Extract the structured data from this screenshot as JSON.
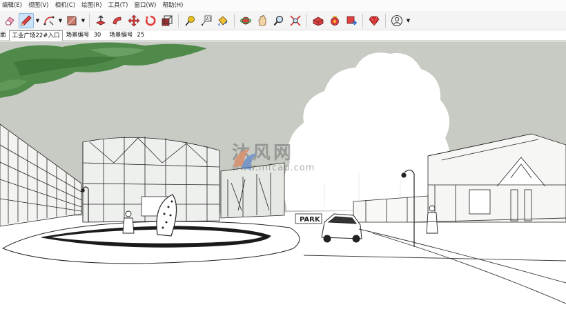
{
  "menu": [
    {
      "label": "编辑(E)"
    },
    {
      "label": "视图(V)"
    },
    {
      "label": "相机(C)"
    },
    {
      "label": "绘图(R)"
    },
    {
      "label": "工具(T)"
    },
    {
      "label": "窗口(W)"
    },
    {
      "label": "帮助(H)"
    }
  ],
  "toolbar": {
    "groups": [
      [
        "eraser-icon",
        "pencil-icon",
        "arc-icon",
        "rectangle-icon"
      ],
      [
        "push-pull-icon",
        "follow-me-icon",
        "move-icon",
        "rotate-icon",
        "scale-icon"
      ],
      [
        "tape-measure-icon",
        "text-icon",
        "paint-bucket-icon"
      ],
      [
        "orbit-icon",
        "pan-icon",
        "zoom-icon",
        "zoom-extents-icon"
      ],
      [
        "warehouse-icon",
        "extension-icon",
        "share-model-icon"
      ],
      [
        "ruby-icon"
      ],
      [
        "user-icon"
      ]
    ],
    "active_tool": "pencil-icon"
  },
  "scenes": {
    "first_tab": "面",
    "active_scene": "工业广场22#入口",
    "label1": "场景编号",
    "value1": "30",
    "label2": "场景编号",
    "value2": "25"
  },
  "watermark": {
    "cn": "沐风网",
    "en": "www.mfcad.com"
  },
  "sign_text": "PARK",
  "colors": {
    "accent": "#cde3f7",
    "sky": "#c9ccc6",
    "tree": "#4f8a4a"
  }
}
